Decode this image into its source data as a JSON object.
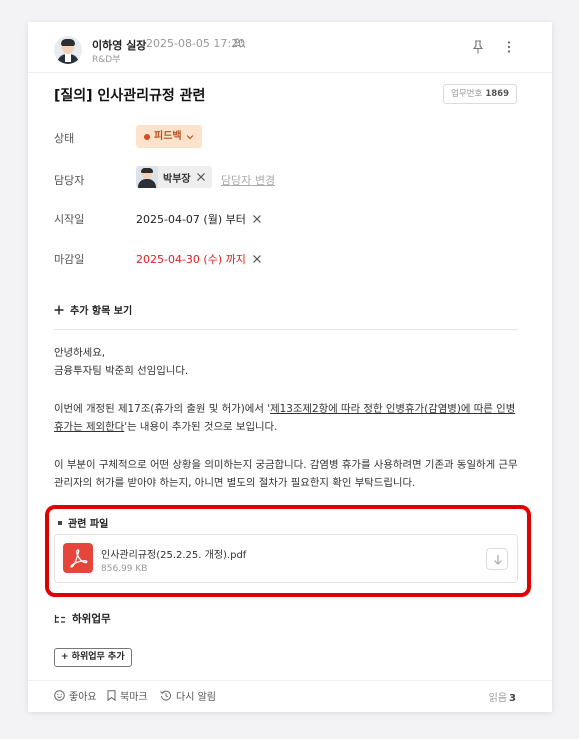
{
  "post": {
    "author_name": "이하영 실장",
    "date": "2025-08-05 17:20",
    "dept": "R&D부",
    "title": "[질의] 인사관리규정 관련",
    "task_no_label": "업무번호",
    "task_no": "1869"
  },
  "fields": {
    "status_label": "상태",
    "status_value": "피드백",
    "assignee_label": "담당자",
    "assignee_name": "박부장",
    "assignee_change": "담당자 변경",
    "start_label": "시작일",
    "start_value": "2025-04-07 (월) 부터",
    "due_label": "마감일",
    "due_value": "2025-04-30 (수) 까지",
    "more_fields": "추가 항목 보기"
  },
  "body": {
    "greeting": "안녕하세요,",
    "intro": "금융투자팀 박준희 선임입니다.",
    "p2_prefix": "이번에 개정된 제17조(휴가의 출원 및 허가)에서 '",
    "p2_link": "제13조제2항에 따라 정한 인병휴가(감염병)에 따른 인병휴가는 제외한다",
    "p2_suffix": "'는 내용이 추가된 것으로 보입니다.",
    "p3": "이 부분이 구체적으로 어떤 상황을 의미하는지 궁금합니다. 감염병 휴가를 사용하려면 기존과 동일하게 근무관리자의 허가를 받아야 하는지, 아니면 별도의 절차가 필요한지 확인 부탁드립니다."
  },
  "files": {
    "section_title": "관련 파일",
    "items": [
      {
        "name": "인사관리규정(25.2.25. 개정).pdf",
        "size": "856.99 KB"
      }
    ]
  },
  "subtasks": {
    "title": "하위업무",
    "add_button": "+ 하위업무 추가"
  },
  "footer": {
    "like": "좋아요",
    "bookmark": "북마크",
    "remind": "다시 알림",
    "read_label": "읽음",
    "read_count": "3"
  },
  "colors": {
    "status_bg": "#fde3cc",
    "status_text": "#b8531c",
    "due_red": "#e02020",
    "pdf_red": "#e5453b",
    "highlight_border": "#e00000"
  }
}
